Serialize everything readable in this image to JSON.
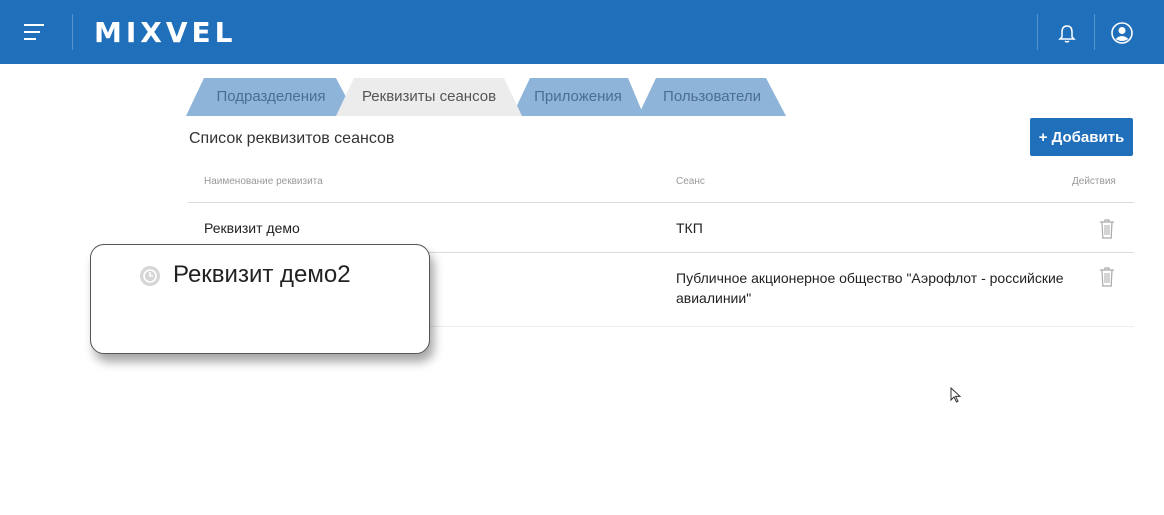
{
  "header": {
    "logo_text": "MIXVEL",
    "brand_color": "#1f6fba",
    "menu_icon": "hamburger-icon",
    "notifications_icon": "bell-icon",
    "user_icon": "user-avatar-icon"
  },
  "tabs": [
    {
      "label": "Подразделения",
      "active": false
    },
    {
      "label": "Реквизиты сеансов",
      "active": true
    },
    {
      "label": "Приложения",
      "active": false
    },
    {
      "label": "Пользователи",
      "active": false
    }
  ],
  "section": {
    "title": "Список реквизитов сеансов",
    "add_button_label": "+ Добавить"
  },
  "table": {
    "columns": [
      "Наименование реквизита",
      "Сеанс",
      "Действия"
    ],
    "rows": [
      {
        "name": "Реквизит демо",
        "session": "ТКП",
        "action_icon": "trash-icon"
      },
      {
        "name": "Реквизит демо2",
        "session_line1": "Публичное акционерное общество \"Аэрофлот - российские",
        "session_line2": "авиалинии\"",
        "action_icon": "trash-icon"
      }
    ]
  },
  "tooltip": {
    "text": "Реквизит демо2",
    "icon": "history-icon"
  }
}
